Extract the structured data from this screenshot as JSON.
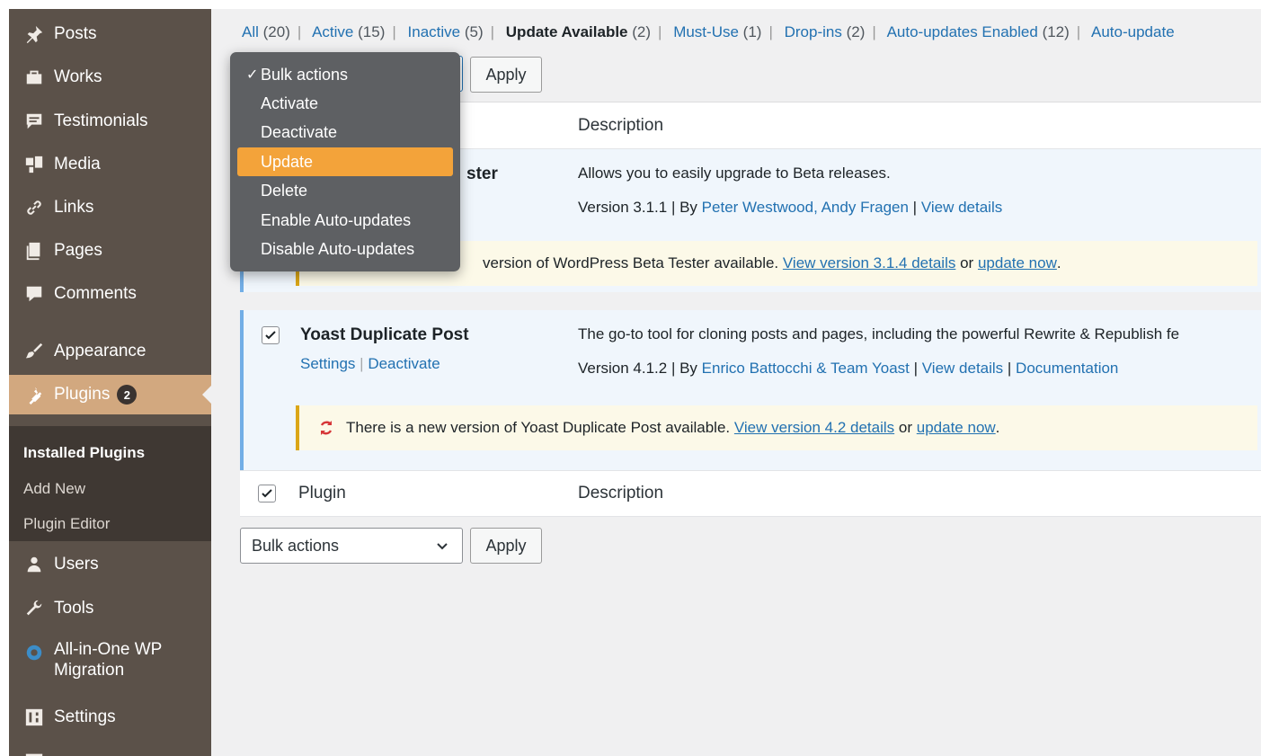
{
  "sidebar": {
    "items": [
      {
        "label": "Posts",
        "icon": "pushpin-icon"
      },
      {
        "label": "Works",
        "icon": "portfolio-icon"
      },
      {
        "label": "Testimonials",
        "icon": "testimonial-icon"
      },
      {
        "label": "Media",
        "icon": "media-icon"
      },
      {
        "label": "Links",
        "icon": "link-icon"
      },
      {
        "label": "Pages",
        "icon": "pages-icon"
      },
      {
        "label": "Comments",
        "icon": "comment-icon"
      },
      {
        "label": "Appearance",
        "icon": "brush-icon"
      },
      {
        "label": "Plugins",
        "icon": "plugin-icon",
        "badge": "2"
      },
      {
        "label": "Users",
        "icon": "user-icon"
      },
      {
        "label": "Tools",
        "icon": "wrench-icon"
      },
      {
        "label": "All-in-One WP\nMigration",
        "icon": "migration-icon"
      },
      {
        "label": "Settings",
        "icon": "settings-icon"
      }
    ],
    "submenu": [
      "Installed Plugins",
      "Add New",
      "Plugin Editor"
    ]
  },
  "views": {
    "all": "All",
    "all_count": "(20)",
    "active": "Active",
    "active_count": "(15)",
    "inactive": "Inactive",
    "inactive_count": "(5)",
    "update": "Update Available",
    "update_count": "(2)",
    "mustuse": "Must-Use",
    "mustuse_count": "(1)",
    "dropins": "Drop-ins",
    "dropins_count": "(2)",
    "autoen": "Auto-updates Enabled",
    "autoen_count": "(12)",
    "autodis": "Auto-update"
  },
  "bulk": {
    "select_label": "Bulk actions",
    "apply": "Apply",
    "options": [
      "Bulk actions",
      "Activate",
      "Deactivate",
      "Update",
      "Delete",
      "Enable Auto-updates",
      "Disable Auto-updates"
    ],
    "checked_option": "Bulk actions",
    "highlighted_option": "Update"
  },
  "table": {
    "col_description": "Description",
    "col_plugin": "Plugin",
    "plugins": [
      {
        "name_tail": "ster",
        "description": "Allows you to easily upgrade to Beta releases.",
        "version": "Version 3.1.1 | By ",
        "authors": "Peter Westwood, Andy Fragen",
        "sep": " | ",
        "view_details": "View details",
        "notice_text": "version of WordPress Beta Tester available.",
        "notice_link": "View version 3.1.4 details",
        "notice_or": "or",
        "notice_update": "update now",
        "notice_end": "."
      },
      {
        "name": "Yoast Duplicate Post",
        "settings": "Settings",
        "action_sep": "|",
        "deactivate": "Deactivate",
        "description": "The go-to tool for cloning posts and pages, including the powerful Rewrite & Republish fe",
        "version": "Version 4.1.2 | By ",
        "authors": "Enrico Battocchi & Team Yoast",
        "sep": " | ",
        "view_details": "View details",
        "sep2": " | ",
        "documentation": "Documentation",
        "notice_text": "There is a new version of Yoast Duplicate Post available.",
        "notice_link": "View version 4.2 details",
        "notice_or": "or",
        "notice_update": "update now",
        "notice_end": "."
      }
    ]
  },
  "colors": {
    "sidebar_bg": "#5b5149",
    "plugins_active": "#d2a87f",
    "link": "#2271b1",
    "update_highlight": "#f3a33a",
    "notice_border": "#dba617",
    "notice_icon": "#d63638"
  }
}
